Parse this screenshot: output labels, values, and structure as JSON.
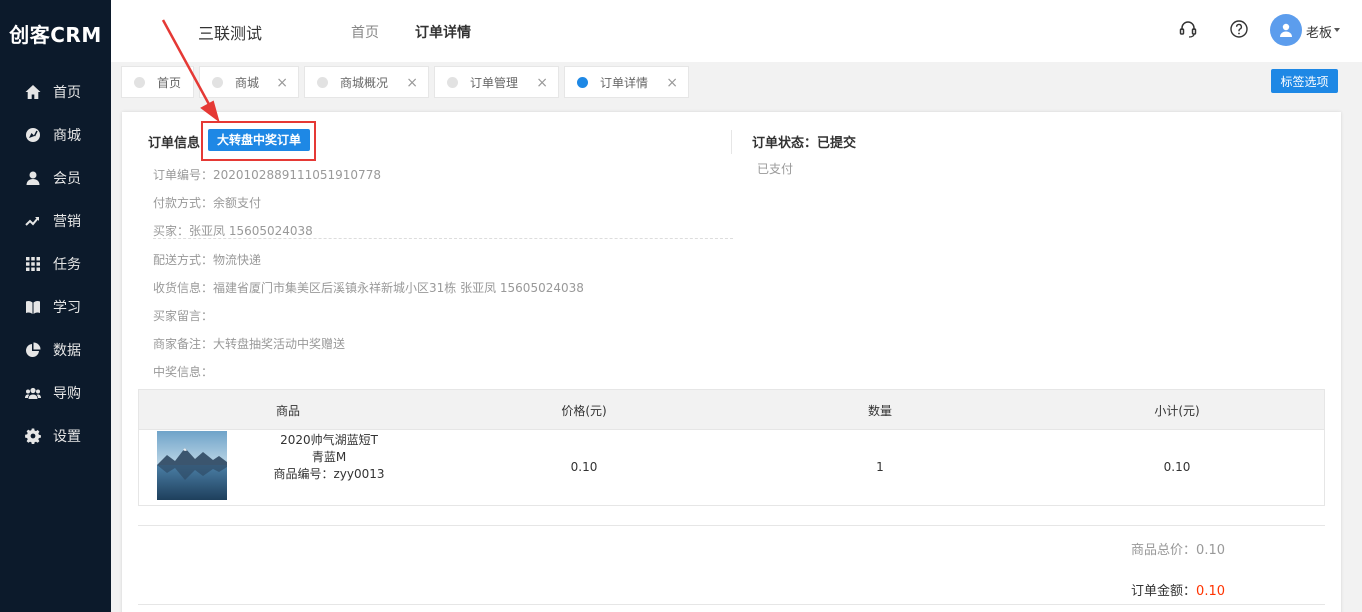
{
  "app": {
    "logo": "创客CRM"
  },
  "sidebar": {
    "items": [
      {
        "label": "首页",
        "icon": "home-icon"
      },
      {
        "label": "商城",
        "icon": "compass-icon"
      },
      {
        "label": "会员",
        "icon": "user-icon"
      },
      {
        "label": "营销",
        "icon": "trend-icon"
      },
      {
        "label": "任务",
        "icon": "grid-icon"
      },
      {
        "label": "学习",
        "icon": "book-icon"
      },
      {
        "label": "数据",
        "icon": "pie-icon"
      },
      {
        "label": "导购",
        "icon": "group-icon"
      },
      {
        "label": "设置",
        "icon": "gear-icon"
      }
    ]
  },
  "header": {
    "company": "三联测试",
    "links": [
      "首页",
      "订单详情"
    ],
    "user": "老板"
  },
  "tabs": [
    {
      "label": "首页",
      "closable": false
    },
    {
      "label": "商城",
      "closable": true
    },
    {
      "label": "商城概况",
      "closable": true
    },
    {
      "label": "订单管理",
      "closable": true
    },
    {
      "label": "订单详情",
      "closable": true,
      "active": true
    }
  ],
  "tag_options": "标签选项",
  "order": {
    "info_title": "订单信息",
    "badge": "大转盘中奖订单",
    "status_title": "订单状态：已提交",
    "status_sub": "已支付",
    "lines": [
      "订单编号：2020102889111051910778",
      "付款方式：余额支付",
      "买家：张亚凤  15605024038",
      "配送方式：物流快递",
      "收货信息：福建省厦门市集美区后溪镇永祥新城小区31栋  张亚凤  15605024038",
      "买家留言：",
      "商家备注：大转盘抽奖活动中奖赠送",
      "中奖信息："
    ]
  },
  "table": {
    "headers": [
      "商品",
      "价格(元)",
      "数量",
      "小计(元)"
    ],
    "row": {
      "name_line1": "2020帅气湖蓝短T",
      "name_line2": "青蓝M",
      "name_line3": "商品编号：zyy0013",
      "price": "0.10",
      "qty": "1",
      "subtotal": "0.10"
    }
  },
  "totals": {
    "goods_label": "商品总价：",
    "goods_value": "0.10",
    "amount_label": "订单金额：",
    "amount_value": "0.10"
  },
  "colors": {
    "sidebar": "#0c1a2b",
    "accent": "#1e88e5",
    "price_red": "#ff3300",
    "annotation_red": "#e53935"
  }
}
